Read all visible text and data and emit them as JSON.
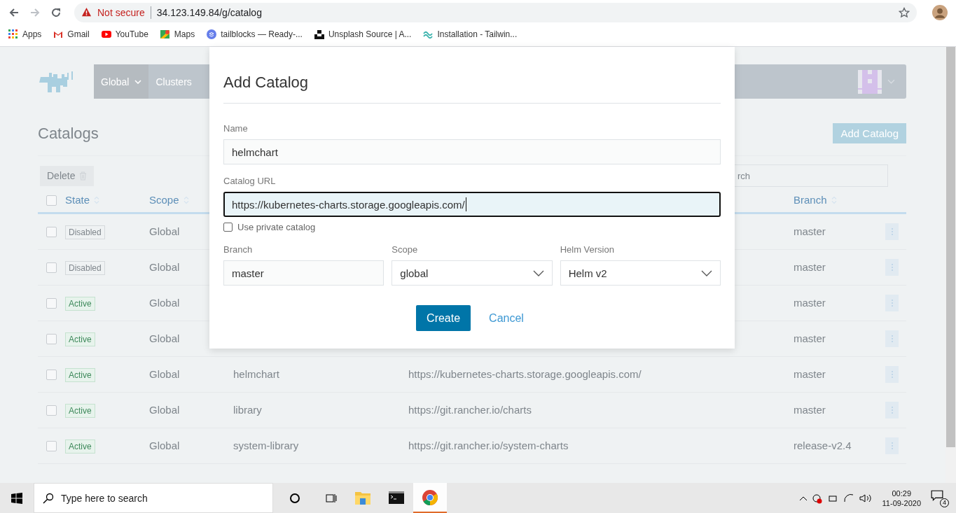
{
  "browser": {
    "security": "Not secure",
    "url": "34.123.149.84/g/catalog",
    "bookmarks": [
      {
        "label": "Apps"
      },
      {
        "label": "Gmail"
      },
      {
        "label": "YouTube"
      },
      {
        "label": "Maps"
      },
      {
        "label": "tailblocks — Ready-..."
      },
      {
        "label": "Unsplash Source | A..."
      },
      {
        "label": "Installation - Tailwin..."
      }
    ]
  },
  "header": {
    "nav": [
      {
        "label": "Global",
        "dropdown": true
      },
      {
        "label": "Clusters",
        "dropdown": false
      }
    ]
  },
  "page": {
    "title": "Catalogs",
    "add_button": "Add Catalog",
    "delete_button": "Delete",
    "search": {
      "placeholder": "rch"
    },
    "select_all_checked": false,
    "columns": [
      "State",
      "Scope",
      "",
      "",
      "Branch"
    ],
    "rows": [
      {
        "checked": false,
        "state": {
          "label": "Disabled",
          "kind": "disabled"
        },
        "scope": "Global",
        "branch": "master"
      },
      {
        "checked": false,
        "state": {
          "label": "Disabled",
          "kind": "disabled"
        },
        "scope": "Global",
        "branch": "master"
      },
      {
        "checked": false,
        "state": {
          "label": "Active",
          "kind": "active"
        },
        "scope": "Global",
        "branch": "master"
      },
      {
        "checked": false,
        "state": {
          "label": "Active",
          "kind": "active"
        },
        "scope": "Global",
        "branch": "master"
      },
      {
        "checked": false,
        "state": {
          "label": "Active",
          "kind": "active"
        },
        "scope": "Global",
        "name": "helmchart",
        "url": "https://kubernetes-charts.storage.googleapis.com/",
        "branch": "master"
      },
      {
        "checked": false,
        "state": {
          "label": "Active",
          "kind": "active"
        },
        "scope": "Global",
        "name": "library",
        "url": "https://git.rancher.io/charts",
        "branch": "master"
      },
      {
        "checked": false,
        "state": {
          "label": "Active",
          "kind": "active"
        },
        "scope": "Global",
        "name": "system-library",
        "url": "https://git.rancher.io/system-charts",
        "branch": "release-v2.4"
      }
    ]
  },
  "modal": {
    "title": "Add Catalog",
    "name": {
      "label": "Name",
      "value": "helmchart"
    },
    "url": {
      "label": "Catalog URL",
      "value": "https://kubernetes-charts.storage.googleapis.com/",
      "focused": true
    },
    "private": {
      "label": "Use private catalog",
      "checked": false
    },
    "branch": {
      "label": "Branch",
      "value": "master"
    },
    "scope": {
      "label": "Scope",
      "value": "global"
    },
    "helm": {
      "label": "Helm Version",
      "value": "Helm v2"
    },
    "create": "Create",
    "cancel": "Cancel"
  },
  "taskbar": {
    "search_placeholder": "Type here to search",
    "apps": [
      {
        "selected": false
      },
      {
        "selected": false
      },
      {
        "selected": true
      }
    ],
    "time": "00:29",
    "date": "11-09-2020",
    "notifications": "4"
  }
}
